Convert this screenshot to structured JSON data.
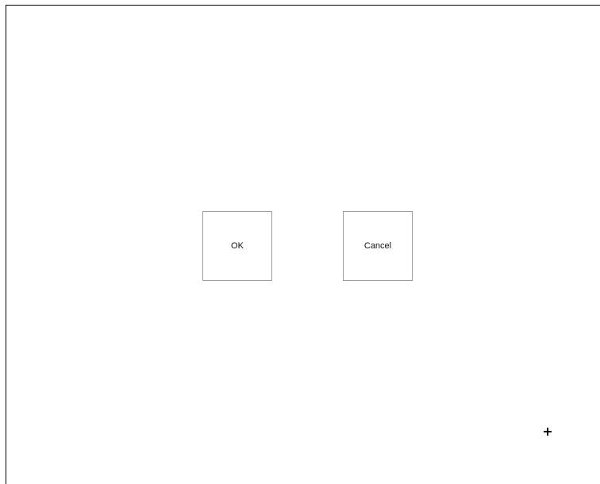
{
  "dialog": {
    "ok_label": "OK",
    "cancel_label": "Cancel"
  },
  "cursor": {
    "icon": "crosshair-cursor-icon"
  },
  "colors": {
    "background": "#ffffff",
    "frame_border": "#000000",
    "button_border": "#9c9c9c",
    "text": "#111111"
  }
}
